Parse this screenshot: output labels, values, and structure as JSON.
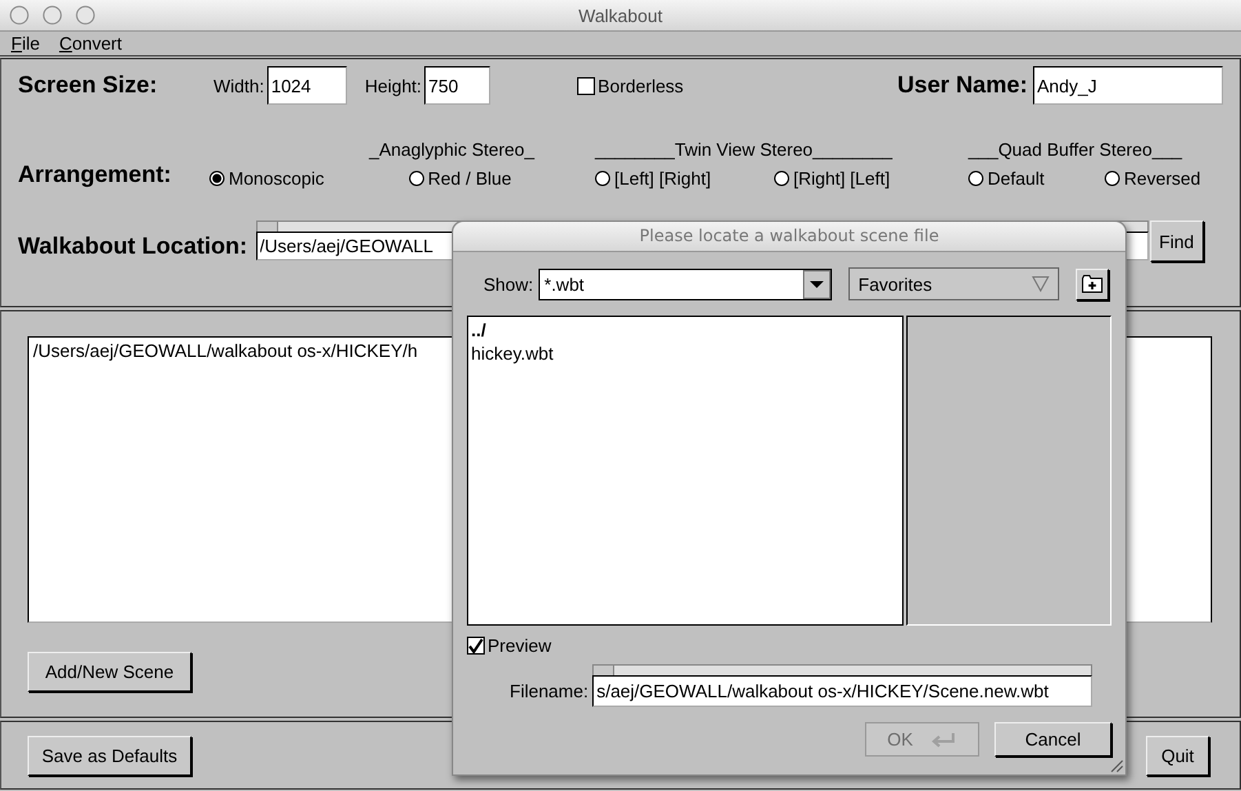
{
  "window": {
    "title": "Walkabout"
  },
  "menu": [
    {
      "label": "File"
    },
    {
      "label": "Convert"
    }
  ],
  "screen_size": {
    "label": "Screen Size:",
    "width": {
      "label": "Width:",
      "value": "1024"
    },
    "height": {
      "label": "Height:",
      "value": "750"
    },
    "borderless": {
      "label": "Borderless",
      "checked": false
    },
    "user_name": {
      "label": "User Name:",
      "value": "Andy_J"
    }
  },
  "arrangement": {
    "label": "Arrangement:",
    "groups": [
      {
        "options": [
          {
            "label": "Monoscopic",
            "selected": true
          }
        ]
      },
      {
        "title": "_Anaglyphic Stereo_",
        "options": [
          {
            "label": "Red / Blue",
            "selected": false
          }
        ]
      },
      {
        "title": "________Twin View Stereo________",
        "options": [
          {
            "label": "[Left] [Right]",
            "selected": false
          },
          {
            "label": "[Right] [Left]",
            "selected": false
          }
        ]
      },
      {
        "title": "___Quad Buffer Stereo___",
        "options": [
          {
            "label": "Default",
            "selected": false
          },
          {
            "label": "Reversed",
            "selected": false
          }
        ]
      }
    ]
  },
  "location": {
    "label": "Walkabout Location:",
    "value": "/Users/aej/GEOWALL",
    "button": "Find"
  },
  "scenes": {
    "items": [
      "/Users/aej/GEOWALL/walkabout os-x/HICKEY/h"
    ],
    "button": "Add/New Scene"
  },
  "footer": {
    "buttons": [
      {
        "label": "Save as Defaults"
      },
      {
        "label": "Quit"
      }
    ]
  },
  "dialog": {
    "title": "Please locate a walkabout scene file",
    "show": {
      "label": "Show:",
      "value": "*.wbt"
    },
    "favorites": "Favorites",
    "files": [
      {
        "name": "../",
        "kind": "parent"
      },
      {
        "name": "hickey.wbt",
        "kind": "file"
      }
    ],
    "preview": {
      "label": "Preview",
      "checked": true
    },
    "filename": {
      "label": "Filename:",
      "value": "s/aej/GEOWALL/walkabout os-x/HICKEY/Scene.new.wbt"
    },
    "buttons": [
      {
        "label": "OK",
        "disabled": true
      },
      {
        "label": "Cancel",
        "disabled": false
      }
    ]
  }
}
